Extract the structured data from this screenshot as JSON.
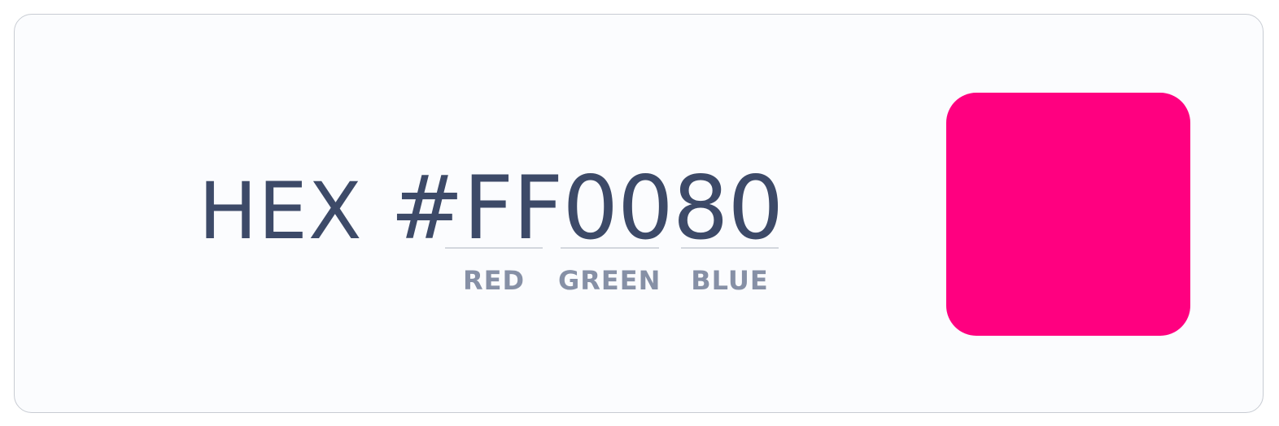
{
  "hex": {
    "prefix": "HEX",
    "value": "#FF0080"
  },
  "channels": [
    {
      "label": "RED"
    },
    {
      "label": "GREEN"
    },
    {
      "label": "BLUE"
    }
  ],
  "swatch": {
    "color": "#FF0080"
  },
  "colors": {
    "text": "#3D4A68",
    "channel_label": "#8690A6",
    "card_background": "#FBFCFE",
    "card_border": "#C8CCD3"
  }
}
